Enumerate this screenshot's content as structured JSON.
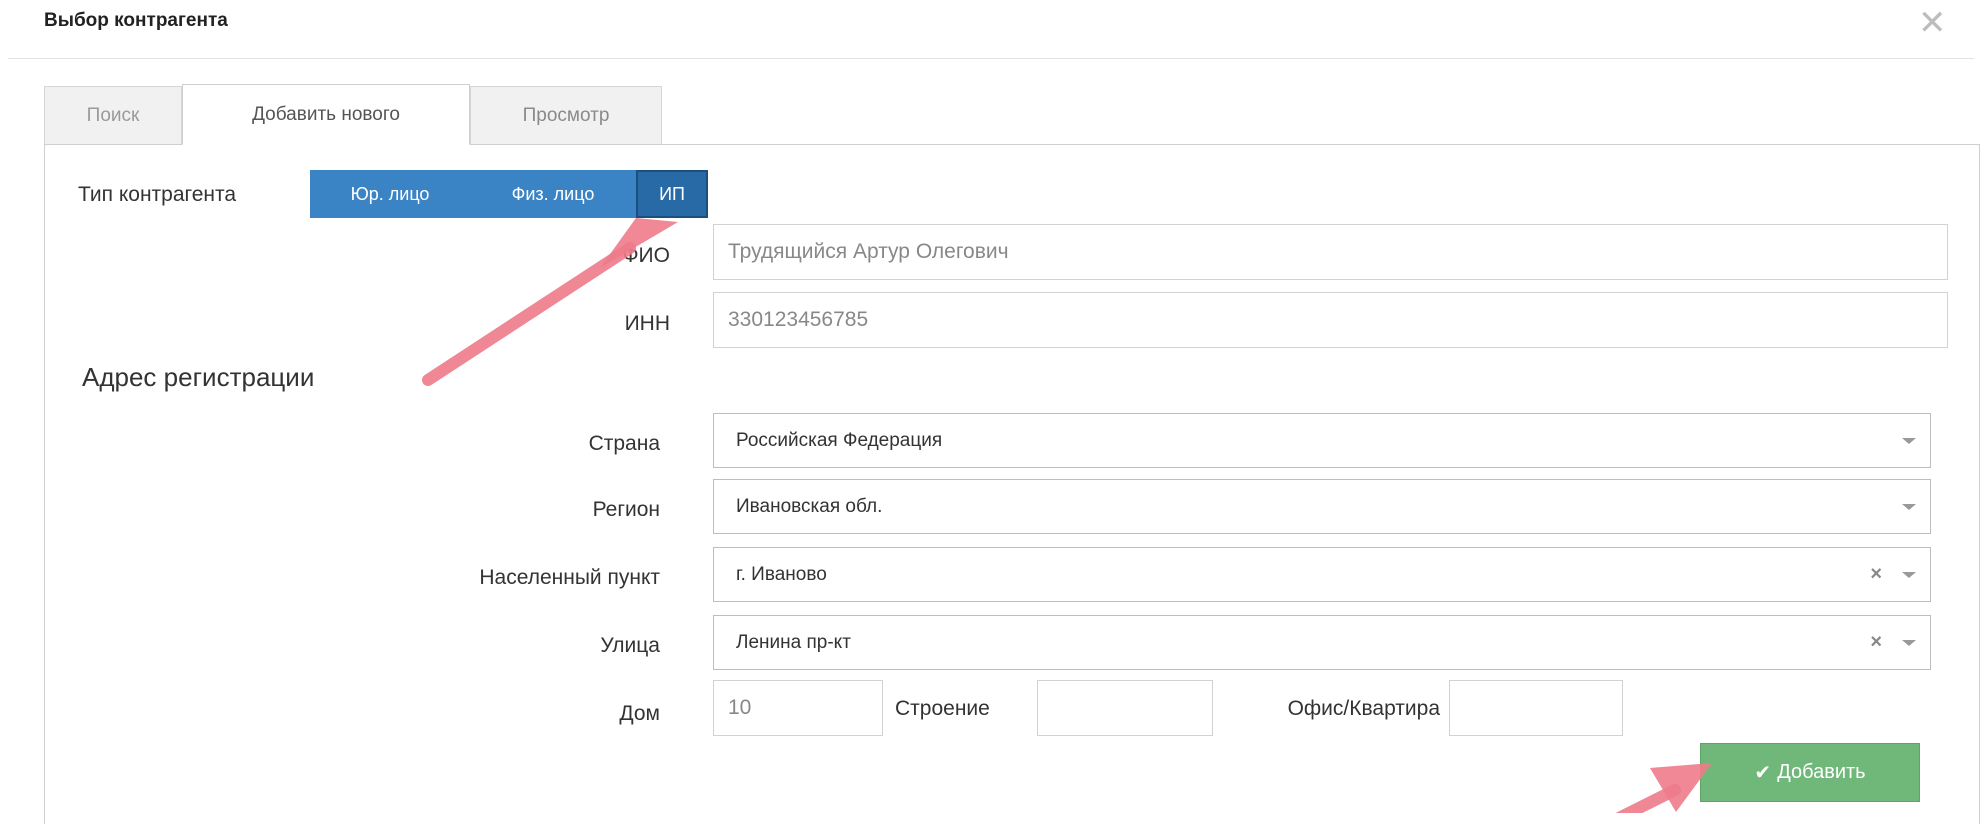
{
  "dialog": {
    "title": "Выбор контрагента",
    "close_icon": "close-icon"
  },
  "tabs": [
    {
      "label": "Поиск",
      "active": false
    },
    {
      "label": "Добавить нового",
      "active": true
    },
    {
      "label": "Просмотр",
      "active": false
    }
  ],
  "contractor_type": {
    "label": "Тип контрагента",
    "options": [
      "Юр. лицо",
      "Физ. лицо",
      "ИП"
    ],
    "selected": "ИП"
  },
  "fields": {
    "fio": {
      "label": "ФИО",
      "value": "Трудящийся Артур Олегович"
    },
    "inn": {
      "label": "ИНН",
      "value": "330123456785"
    }
  },
  "address": {
    "title": "Адрес регистрации",
    "country": {
      "label": "Страна",
      "value": "Российская Федерация"
    },
    "region": {
      "label": "Регион",
      "value": "Ивановская обл."
    },
    "locality": {
      "label": "Населенный пункт",
      "value": "г. Иваново"
    },
    "street": {
      "label": "Улица",
      "value": "Ленина пр-кт"
    },
    "house": {
      "label": "Дом",
      "value": "10"
    },
    "building": {
      "label": "Строение",
      "value": ""
    },
    "office": {
      "label": "Офис/Квартира",
      "value": ""
    }
  },
  "actions": {
    "add_label": "Добавить",
    "add_icon": "check-icon"
  },
  "colors": {
    "segment_blue": "#3a83c4",
    "segment_active": "#286aa6",
    "add_button_green": "#6fb87a",
    "annotation_arrow": "#ee7b8a"
  }
}
